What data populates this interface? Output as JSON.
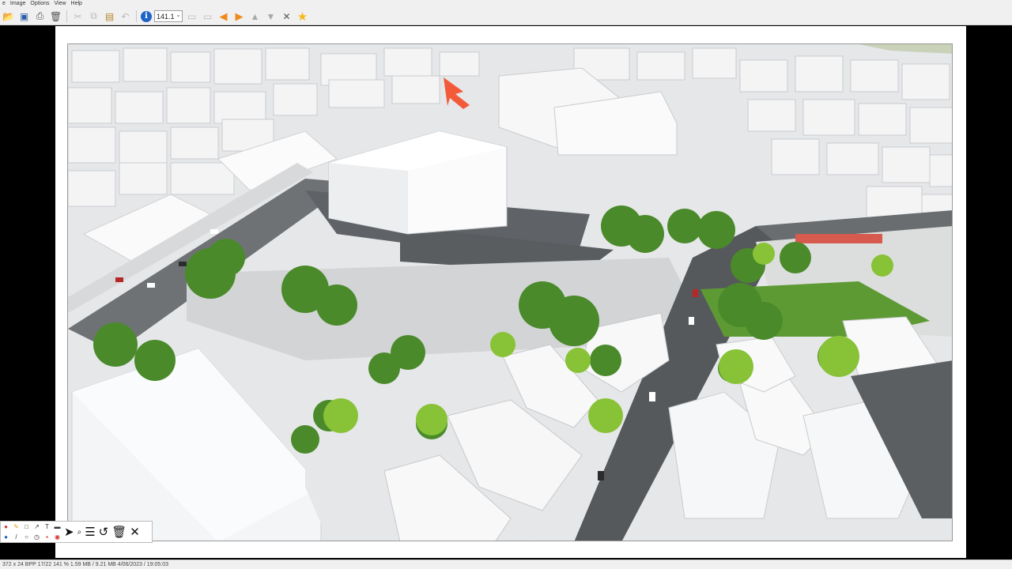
{
  "menu": [
    "e",
    "Image",
    "Options",
    "View",
    "Help"
  ],
  "toolbar": {
    "zoom_value": "141.1",
    "icons": [
      "open-icon",
      "save-icon",
      "print-icon",
      "delete-icon",
      "cut-icon",
      "copy-icon",
      "paste-icon",
      "undo-icon",
      "info-icon",
      "zoom-select",
      "fit-window-icon",
      "fit-width-icon",
      "prev-arrow-icon",
      "next-arrow-icon",
      "up-arrow-icon",
      "down-arrow-icon",
      "tools-icon",
      "favorites-star-icon"
    ]
  },
  "status": {
    "text": "372 x 24 BPP   17/22   141 %   1.59 MB / 9.21 MB   4/06/2023 / 19:05:03"
  },
  "annotation_toolbar": {
    "icons": [
      "pencil-icon",
      "highlighter-icon",
      "rectangle-icon",
      "line-icon",
      "text-icon",
      "color-icon",
      "ellipse-icon",
      "arrow-tool-icon",
      "cursor-icon",
      "zoom-icon",
      "menu-icon",
      "undo-icon",
      "trash-icon",
      "close-icon"
    ]
  },
  "colors": {
    "accent_orange": "#f08a1c",
    "info_blue": "#1e64c8",
    "tree_green": "#4f8f2c",
    "red_arrow": "#f25a3a"
  }
}
